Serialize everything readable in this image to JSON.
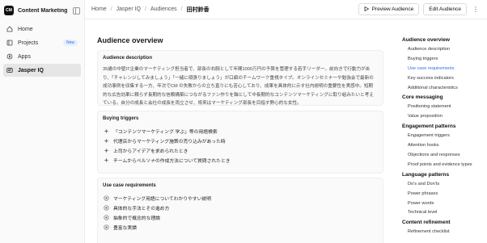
{
  "sidebar": {
    "workspace_logo": "CM",
    "workspace_name": "Content Marketing Ac...",
    "items": [
      {
        "label": "Home",
        "icon": "home-icon",
        "badge": ""
      },
      {
        "label": "Projects",
        "icon": "folder-icon",
        "badge": "New"
      },
      {
        "label": "Apps",
        "icon": "apps-icon",
        "badge": ""
      },
      {
        "label": "Jasper IQ",
        "icon": "iq-icon",
        "badge": "",
        "active": true
      }
    ]
  },
  "breadcrumb": {
    "items": [
      "Home",
      "Jasper IQ",
      "Audiences"
    ],
    "current": "田村鈴香",
    "separator": "/"
  },
  "toolbar": {
    "preview_label": "Preview Audience",
    "edit_label": "Edit Audience",
    "more_label": "⋮"
  },
  "main": {
    "title": "Audience overview",
    "description": {
      "heading": "Audience description",
      "text": "35歳の中堅IT企業のマーケティング担当者で、部長の右腕として年間1000万円の予算を管理する若手リーダー。前向きで行動力があり、「チャレンジしてみましょう」「一緒に頑張りましょう」が口癖のチームワーク重視タイプ。オンラインセミナーや勉強会で最新の成功事例を収集する一方、年次でCM の失敗からの立ち直りにも苦心しており、成果を具体的に示す社内説明の重要性を実感中。短期的な広告効果に頼らず長期的な信頼構築につながるファン作りを軸として中長期的なコンテンツマーケティングに取り組みたいと考えている。自分の成長と会社の成長を両立させ、将来はマーケティング部長を目指す野心的な女性。"
    },
    "buying_triggers": {
      "heading": "Buying triggers",
      "items": [
        "「コンテンツマーケティング 学ぶ」等の用語検索",
        "代理店からマーケティング施策の売り込みがあった時",
        "上司からアイデアを求められたとき",
        "チームからペルソナの作成方法について質問されたとき"
      ]
    },
    "use_case": {
      "heading": "Use case requirements",
      "items": [
        "マーケティング用語についてわかりやすい説明",
        "具体的な手法とその進め方",
        "抽象的で概念的な理論",
        "豊富な実績"
      ]
    }
  },
  "toc": [
    {
      "label": "Audience overview",
      "children": [
        "Audience description",
        "Buying triggers",
        "Use case requirements",
        "Key success indicators",
        "Additional characteristics"
      ]
    },
    {
      "label": "Core messaging",
      "children": [
        "Positioning statement",
        "Value proposition"
      ]
    },
    {
      "label": "Engagement patterns",
      "children": [
        "Engagement triggers",
        "Attention hooks",
        "Objections and responses",
        "Proof points and evidence types"
      ]
    },
    {
      "label": "Language patterns",
      "children": [
        "Do's and Don'ts",
        "Power phrases",
        "Power words",
        "Technical level"
      ]
    },
    {
      "label": "Content refinement",
      "children": [
        "Refinement checklist"
      ]
    }
  ],
  "toc_active": "Use case requirements",
  "colors": {
    "accent": "#2f6fe8",
    "active_bg": "#e6e6e6",
    "card_bg": "#fafafa"
  }
}
